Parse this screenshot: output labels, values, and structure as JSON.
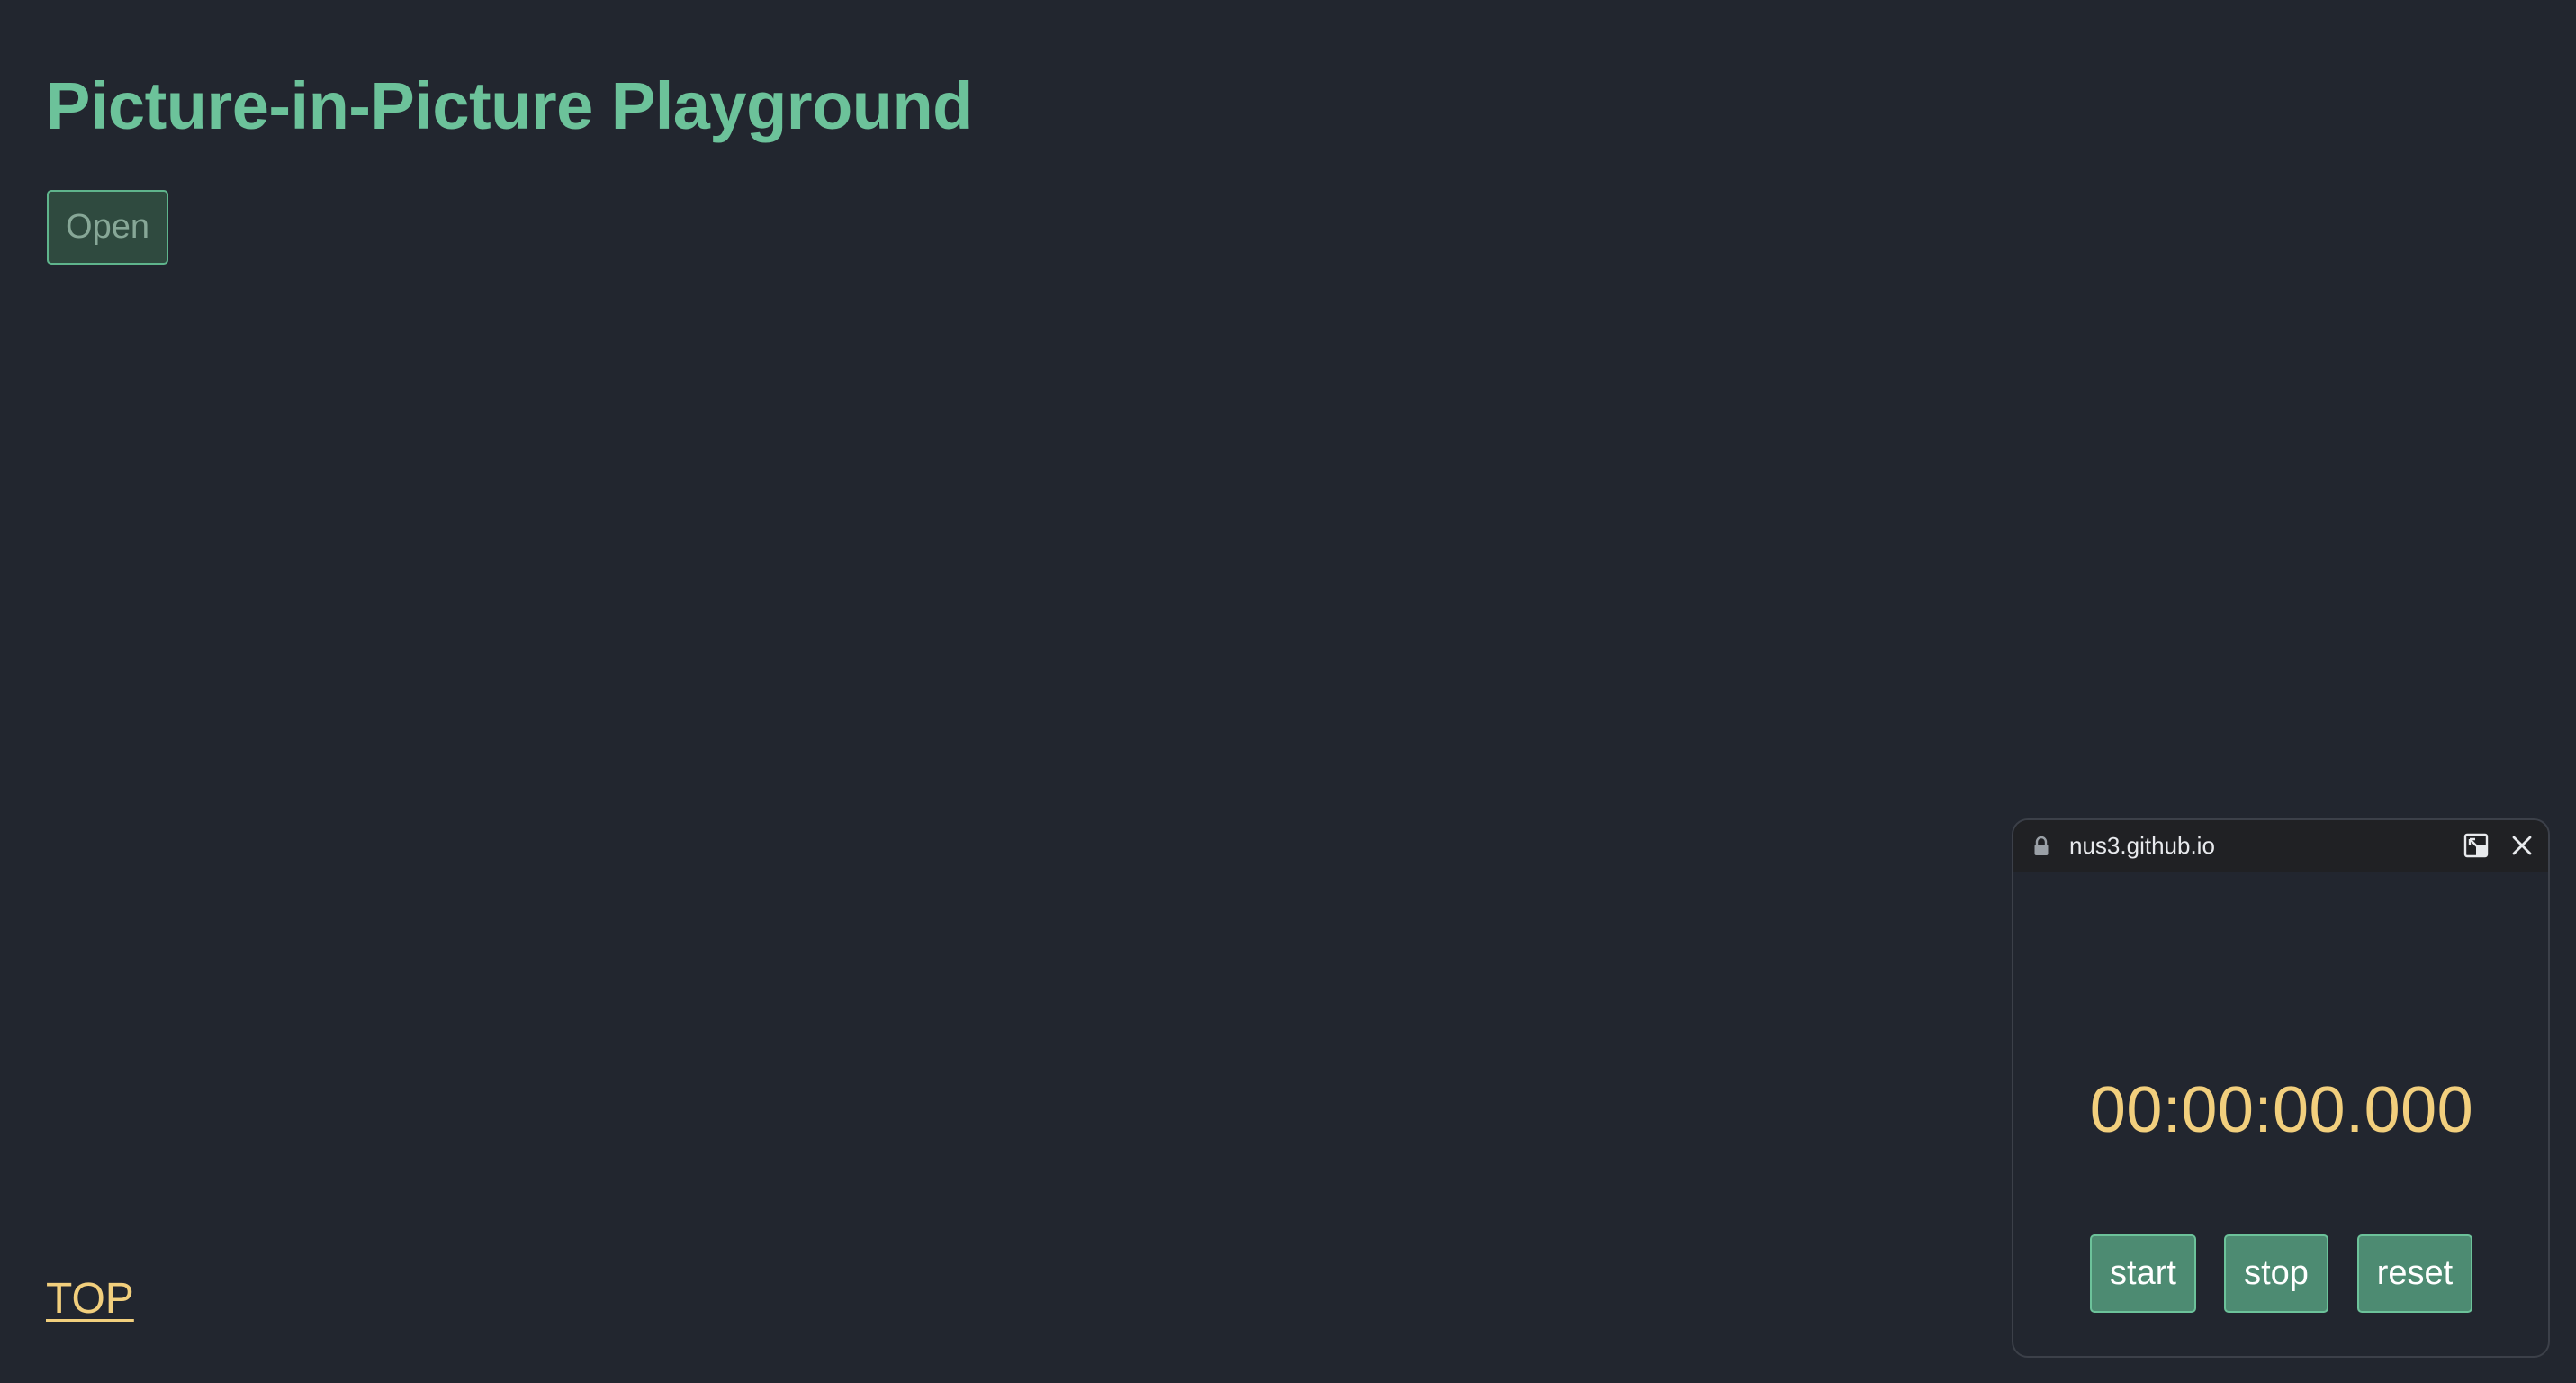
{
  "page": {
    "title": "Picture-in-Picture Playground",
    "open_button_label": "Open",
    "top_link_label": "TOP"
  },
  "pip": {
    "url": "nus3.github.io",
    "timer": "00:00:00.000",
    "buttons": {
      "start": "start",
      "stop": "stop",
      "reset": "reset"
    },
    "icons": {
      "lock": "lock-icon",
      "back_to_tab": "back-to-tab-icon",
      "close": "close-icon"
    }
  },
  "colors": {
    "background": "#22262f",
    "accent_green": "#6cc29a",
    "button_green": "#4d8b72",
    "timer_yellow": "#f2cf7d",
    "pip_titlebar": "#202124"
  }
}
